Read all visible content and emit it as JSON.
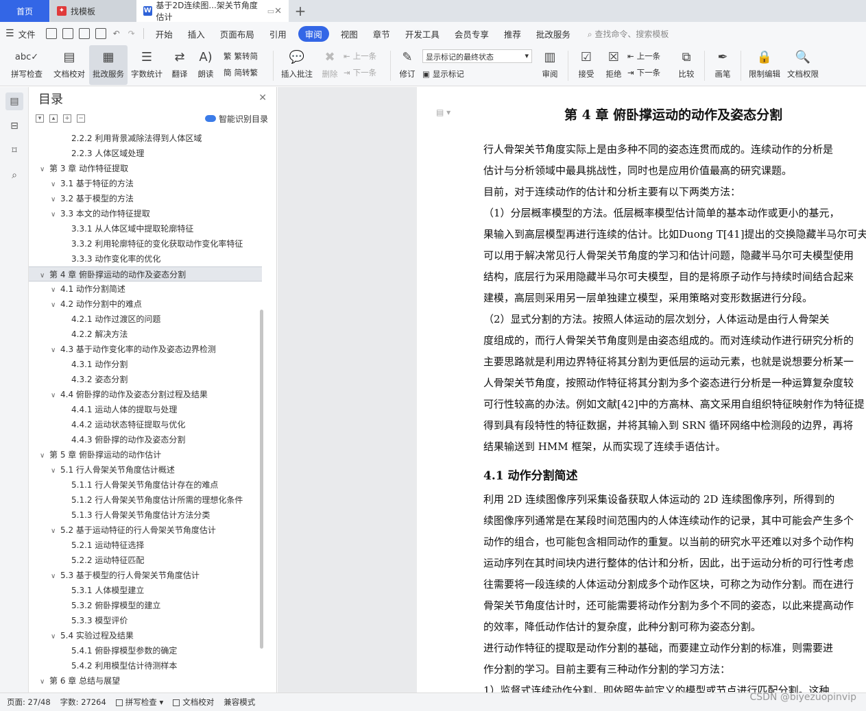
{
  "tabs": {
    "home": "首页",
    "template": "找模板",
    "document": "基于2D连续图...架关节角度估计"
  },
  "menu": {
    "file": "文件",
    "items": [
      "开始",
      "插入",
      "页面布局",
      "引用",
      "审阅",
      "视图",
      "章节",
      "开发工具",
      "会员专享",
      "推荐",
      "批改服务"
    ],
    "active_index": 4,
    "search": "查找命令、搜索模板"
  },
  "ribbon": {
    "spell": "拼写检查",
    "proofread": "文档校对",
    "correct": "批改服务",
    "wordcount": "字数统计",
    "translate": "翻译",
    "read": "朗读",
    "trad": "繁转简",
    "simp": "简转繁",
    "insert_comment": "插入批注",
    "delete": "删除",
    "prev": "上一条",
    "next": "下一条",
    "track": "修订",
    "markup_select": "显示标记的最终状态",
    "show_markup": "显示标记",
    "review": "审阅",
    "accept": "接受",
    "reject": "拒绝",
    "prev2": "上一条",
    "next2": "下一条",
    "compare": "比较",
    "pen": "画笔",
    "restrict": "限制编辑",
    "permission": "文档权限"
  },
  "nav": {
    "title": "目录",
    "smart": "智能识别目录",
    "items": [
      {
        "text": "2.2.2  利用背景减除法得到人体区域",
        "level": 3
      },
      {
        "text": "2.2.3  人体区域处理",
        "level": 3
      },
      {
        "text": "第 3 章  动作特征提取",
        "level": 1
      },
      {
        "text": "3.1  基于特征的方法",
        "level": 2
      },
      {
        "text": "3.2  基于模型的方法",
        "level": 2
      },
      {
        "text": "3.3  本文的动作特征提取",
        "level": 2
      },
      {
        "text": "3.3.1  从人体区域中提取轮廓特征",
        "level": 3
      },
      {
        "text": "3.3.2  利用轮廓特征的变化获取动作变化率特征",
        "level": 3
      },
      {
        "text": "3.3.3  动作变化率的优化",
        "level": 3
      },
      {
        "text": "第 4 章  俯卧撑运动的动作及姿态分割",
        "level": 1
      },
      {
        "text": "4.1  动作分割简述",
        "level": 2
      },
      {
        "text": "4.2  动作分割中的难点",
        "level": 2
      },
      {
        "text": "4.2.1  动作过渡区的问题",
        "level": 3
      },
      {
        "text": "4.2.2  解决方法",
        "level": 3
      },
      {
        "text": "4.3  基于动作变化率的动作及姿态边界检测",
        "level": 2
      },
      {
        "text": "4.3.1  动作分割",
        "level": 3
      },
      {
        "text": "4.3.2  姿态分割",
        "level": 3
      },
      {
        "text": "4.4  俯卧撑的动作及姿态分割过程及结果",
        "level": 2
      },
      {
        "text": "4.4.1  运动人体的提取与处理",
        "level": 3
      },
      {
        "text": "4.4.2  运动状态特征提取与优化",
        "level": 3
      },
      {
        "text": "4.4.3  俯卧撑的动作及姿态分割",
        "level": 3
      },
      {
        "text": "第 5 章  俯卧撑运动的动作估计",
        "level": 1
      },
      {
        "text": "5.1  行人骨架关节角度估计概述",
        "level": 2
      },
      {
        "text": "5.1.1  行人骨架关节角度估计存在的难点",
        "level": 3
      },
      {
        "text": "5.1.2  行人骨架关节角度估计所需的理想化条件",
        "level": 3
      },
      {
        "text": "5.1.3  行人骨架关节角度估计方法分类",
        "level": 3
      },
      {
        "text": "5.2  基于运动特征的行人骨架关节角度估计",
        "level": 2
      },
      {
        "text": "5.2.1  运动特征选择",
        "level": 3
      },
      {
        "text": "5.2.2  运动特征匹配",
        "level": 3
      },
      {
        "text": "5.3  基于模型的行人骨架关节角度估计",
        "level": 2
      },
      {
        "text": "5.3.1  人体模型建立",
        "level": 3
      },
      {
        "text": "5.3.2  俯卧撑模型的建立",
        "level": 3
      },
      {
        "text": "5.3.3  模型评价",
        "level": 3
      },
      {
        "text": "5.4  实验过程及结果",
        "level": 2
      },
      {
        "text": "5.4.1  俯卧撑模型参数的确定",
        "level": 3
      },
      {
        "text": "5.4.2  利用模型估计待测样本",
        "level": 3
      },
      {
        "text": "第 6 章  总结与展望",
        "level": 1
      }
    ],
    "selected_index": 9
  },
  "doc": {
    "chapter_title": "第 4 章   俯卧撑运动的动作及姿态分割",
    "lines_a": [
      "    行人骨架关节角度实际上是由多种不同的姿态连贯而成的。连续动作的分析是",
      "估计与分析领域中最具挑战性，同时也是应用价值最高的研究课题。",
      "    目前，对于连续动作的估计和分析主要有以下两类方法：",
      "    （1）分层概率模型的方法。低层概率模型估计简单的基本动作或更小的基元，",
      "果输入到高层模型再进行连续的估计。比如Duong T[41]提出的交换隐藏半马尔可夫",
      "可以用于解决常见行人骨架关节角度的学习和估计问题，隐藏半马尔可夫模型使用",
      "结构，底层行为采用隐藏半马尔可夫模型，目的是将原子动作与持续时间结合起来",
      "建模，高层则采用另一层单独建立模型，采用策略对变形数据进行分段。",
      "    （2）显式分割的方法。按照人体运动的层次划分，人体运动是由行人骨架关",
      "度组成的，而行人骨架关节角度则是由姿态组成的。而对连续动作进行研究分析的",
      "主要思路就是利用边界特征将其分割为更低层的运动元素，也就是说想要分析某一",
      "人骨架关节角度，按照动作特征将其分割为多个姿态进行分析是一种运算复杂度较",
      "可行性较高的办法。例如文献[42]中的方高林、高文采用自组织特征映射作为特征提",
      "得到具有段特性的特征数据，并将其输入到 SRN 循环网络中检测段的边界，再将",
      "结果输送到 HMM 框架，从而实现了连续手语估计。"
    ],
    "section_title": "4.1    动作分割简述",
    "lines_b": [
      "    利用 2D 连续图像序列采集设备获取人体运动的 2D 连续图像序列，所得到的",
      "续图像序列通常是在某段时间范围内的人体连续动作的记录，其中可能会产生多个",
      "动作的组合，也可能包含相同动作的重复。以当前的研究水平还难以对多个动作构",
      "运动序列在其时间块内进行整体的估计和分析，因此，出于运动分析的可行性考虑",
      "往需要将一段连续的人体运动分割成多个动作区块，可称之为动作分割。而在进行",
      "骨架关节角度估计时，还可能需要将动作分割为多个不同的姿态，以此来提高动作",
      "的效率，降低动作估计的复杂度，此种分割可称为姿态分割。",
      "    进行动作特征的提取是动作分割的基础，而要建立动作分割的标准，则需要进",
      "作分割的学习。目前主要有三种动作分割的学习方法：",
      "    1）监督式连续动作分割，即依照先前定义的模型或节点进行匹配分割。这种"
    ]
  },
  "status": {
    "page": "页面: 27/48",
    "words": "字数: 27264",
    "spell": "拼写检查",
    "proof": "文档校对",
    "compat": "兼容模式"
  },
  "watermark": "CSDN @biyezuopinvip"
}
